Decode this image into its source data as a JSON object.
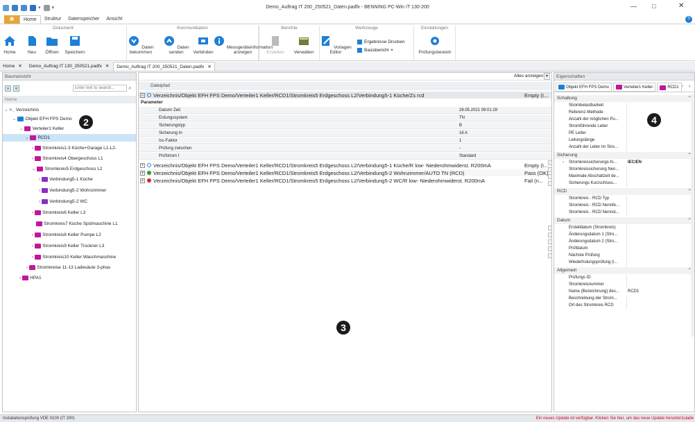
{
  "window": {
    "title": "Demo_Auftrag IT 200_250521_Daten.padfx - BENNING PC-Win IT 130-200"
  },
  "ribbon_tabs": [
    "Home",
    "Struktur",
    "Datenspeicher",
    "Ansicht"
  ],
  "ribbon_file_label": "▣",
  "ribbon": {
    "groups": {
      "dokument": "Dokument",
      "kommunikation": "Kommunikation",
      "berichte": "Berichte",
      "werkzeuge": "Werkzeuge",
      "einstellungen": "Einstellungen"
    },
    "home": "Home",
    "neu": "Neu",
    "oeffnen": "Öffnen",
    "speichern": "Speichern",
    "daten_bekommen": "Daten bekommen",
    "daten_senden": "Daten senden",
    "verbinden": "Verbinden",
    "messgeraeteinfo": "Messgeräteinformation anzeigen",
    "erstellen": "Erstellen",
    "verwalten": "Verwalten",
    "vorlagen_editor": "Vorlagen Editor",
    "ergebnisse_drucken": "Ergebnisse Drucken",
    "basisbericht": "Basisbericht",
    "pruefungsbereich": "Prüfungsbereich"
  },
  "doc_tabs": [
    {
      "label": "Home"
    },
    {
      "label": "Demo_Auftrag IT 130_250521.padfx"
    },
    {
      "label": "Demo_Auftrag IT 200_250521_Daten.padfx"
    }
  ],
  "tree": {
    "header": "Baumansicht",
    "search_placeholder": "Enter text to search...",
    "column": "Name",
    "nodes": [
      {
        "label": "Verzeichnis"
      },
      {
        "label": "Objekt EFH FPS Demo"
      },
      {
        "label": "Verteiler1 Keller"
      },
      {
        "label": "RCD1"
      },
      {
        "label": "Stromkreis1-3 Küche+Garage L1-L2-"
      },
      {
        "label": "Stromkreis4 Obergeschoss L1"
      },
      {
        "label": "Stromkreis5 Erdgeschoss L2"
      },
      {
        "label": "Verbindung5-1 Küche"
      },
      {
        "label": "Verbindung5-2 Wohnzimmer"
      },
      {
        "label": "Verbindung5-2 WC"
      },
      {
        "label": "Stromkreis6 Keller L3"
      },
      {
        "label": "Stromkreis7 Küche Spülmaschine L1"
      },
      {
        "label": "Stromkreis8 Keller Pumpe L2"
      },
      {
        "label": "Stromkreis9 Keller Trockner L3"
      },
      {
        "label": "Stromkreis10 Keller Waschmaschine"
      },
      {
        "label": "Stromkreise 11-13 Ladesäule 3-phas"
      },
      {
        "label": "HPA1"
      }
    ]
  },
  "main": {
    "show_all": "Alles anzeigen",
    "path_header": "Dateipfad",
    "first_row": {
      "path": "Verzeichnis/Objekt EFH FPS Demo/Verteiler1 Keller/RCD1/Stromkreis5 Erdgeschoss L2/Verbindung5-1 Küche/Zs rcd",
      "status": "Empty (I..."
    },
    "params_title": "Parameter",
    "params": [
      {
        "key": "Datum/ Zeit",
        "value": "28.05.2021 09:01:28"
      },
      {
        "key": "Erdungssystem",
        "value": "TN"
      },
      {
        "key": "Sicherungstyp",
        "value": "B"
      },
      {
        "key": "Sicherung In",
        "value": "16 A"
      },
      {
        "key": "Isc-Faktor",
        "value": "1"
      },
      {
        "key": "Prüfung zwischen",
        "value": "-"
      },
      {
        "key": "Prüfstrom I",
        "value": "Standard"
      }
    ],
    "rows": [
      {
        "path": "Verzeichnis/Objekt EFH FPS Demo/Verteiler1 Keller/RCD1/Stromkreis5 Erdgeschoss L2/Verbindung5-1 Küche/R low- Niederohmwiderst. R200mA",
        "status": "Empty (I..."
      },
      {
        "path": "Verzeichnis/Objekt EFH FPS Demo/Verteiler1 Keller/RCD1/Stromkreis5 Erdgeschoss L2/Verbindung5-2 Wohnzimmer/AUTO TN (RCD)",
        "status": "Pass (OK)"
      },
      {
        "path": "Verzeichnis/Objekt EFH FPS Demo/Verteiler1 Keller/RCD1/Stromkreis5 Erdgeschoss L2/Verbindung5-2 WC/R low- Niederohmwiderst. R200mA",
        "status": "Fail (n..."
      }
    ]
  },
  "props": {
    "header": "Eigenschaften",
    "tabs": [
      "Objekt EFH FPS Demo",
      "Verteiler1 Keller",
      "RCD1"
    ],
    "sections": [
      {
        "name": "Schaltung",
        "rows": [
          {
            "key": "Strombelastbarkeit",
            "value": ""
          },
          {
            "key": "Referenz-Methode",
            "value": ""
          },
          {
            "key": "Anzahl der möglichen Pu...",
            "value": ""
          },
          {
            "key": "Stromführende Leiter",
            "value": ""
          },
          {
            "key": "PE Leiter",
            "value": ""
          },
          {
            "key": "Leitungslänge",
            "value": ""
          },
          {
            "key": "Anzahl der Leiter im Stro...",
            "value": ""
          }
        ]
      },
      {
        "name": "Sicherung",
        "rows": [
          {
            "key": "Stromkreissicherungs-N...",
            "value": "IEC/EN"
          },
          {
            "key": "Stromkreissicherung Nen...",
            "value": ""
          },
          {
            "key": "Maximale Abschaltzeit de...",
            "value": ""
          },
          {
            "key": "Sicherungs Kurzschluss...",
            "value": ""
          }
        ]
      },
      {
        "name": "RCD",
        "rows": [
          {
            "key": "Stromkreis - RCD Typ",
            "value": ""
          },
          {
            "key": "Stromkreis - RCD Nennfe...",
            "value": ""
          },
          {
            "key": "Stromkreis - RCD Nennst...",
            "value": ""
          }
        ]
      },
      {
        "name": "Datum",
        "rows": [
          {
            "key": "Erstelldatum (Stromkreis)",
            "value": ""
          },
          {
            "key": "Änderungsdatum 1 (Stro...",
            "value": ""
          },
          {
            "key": "Änderungsdatum 2 (Stro...",
            "value": ""
          },
          {
            "key": "Prüfdatum",
            "value": ""
          },
          {
            "key": "Nächste Prüfung",
            "value": ""
          },
          {
            "key": "Wiederholungsprüfung (i...",
            "value": ""
          }
        ]
      },
      {
        "name": "Allgemein",
        "rows": [
          {
            "key": "Prüfungs ID",
            "value": ""
          },
          {
            "key": "Stromkreisnummer",
            "value": ""
          },
          {
            "key": "Name (Bezeichnung) des...",
            "value": "RCD1"
          },
          {
            "key": "Beschreibung der Strom...",
            "value": ""
          },
          {
            "key": "Ort des Stromkreis RCD",
            "value": ""
          }
        ]
      }
    ]
  },
  "callouts": [
    "2",
    "3",
    "4"
  ],
  "status": {
    "left": "Installationsprüfung VDE 0100 (IT 200)",
    "right": "Ein neues Update ist verfügbar. Klicken Sie hier, um das neue Update herunterzulade"
  },
  "colors": {
    "accent": "#1e7fd6",
    "file_tab": "#e8a434",
    "pass": "#2ca02c",
    "fail": "#d62728",
    "circuit_icon": "#c2169c",
    "update_text": "#d0021b"
  }
}
